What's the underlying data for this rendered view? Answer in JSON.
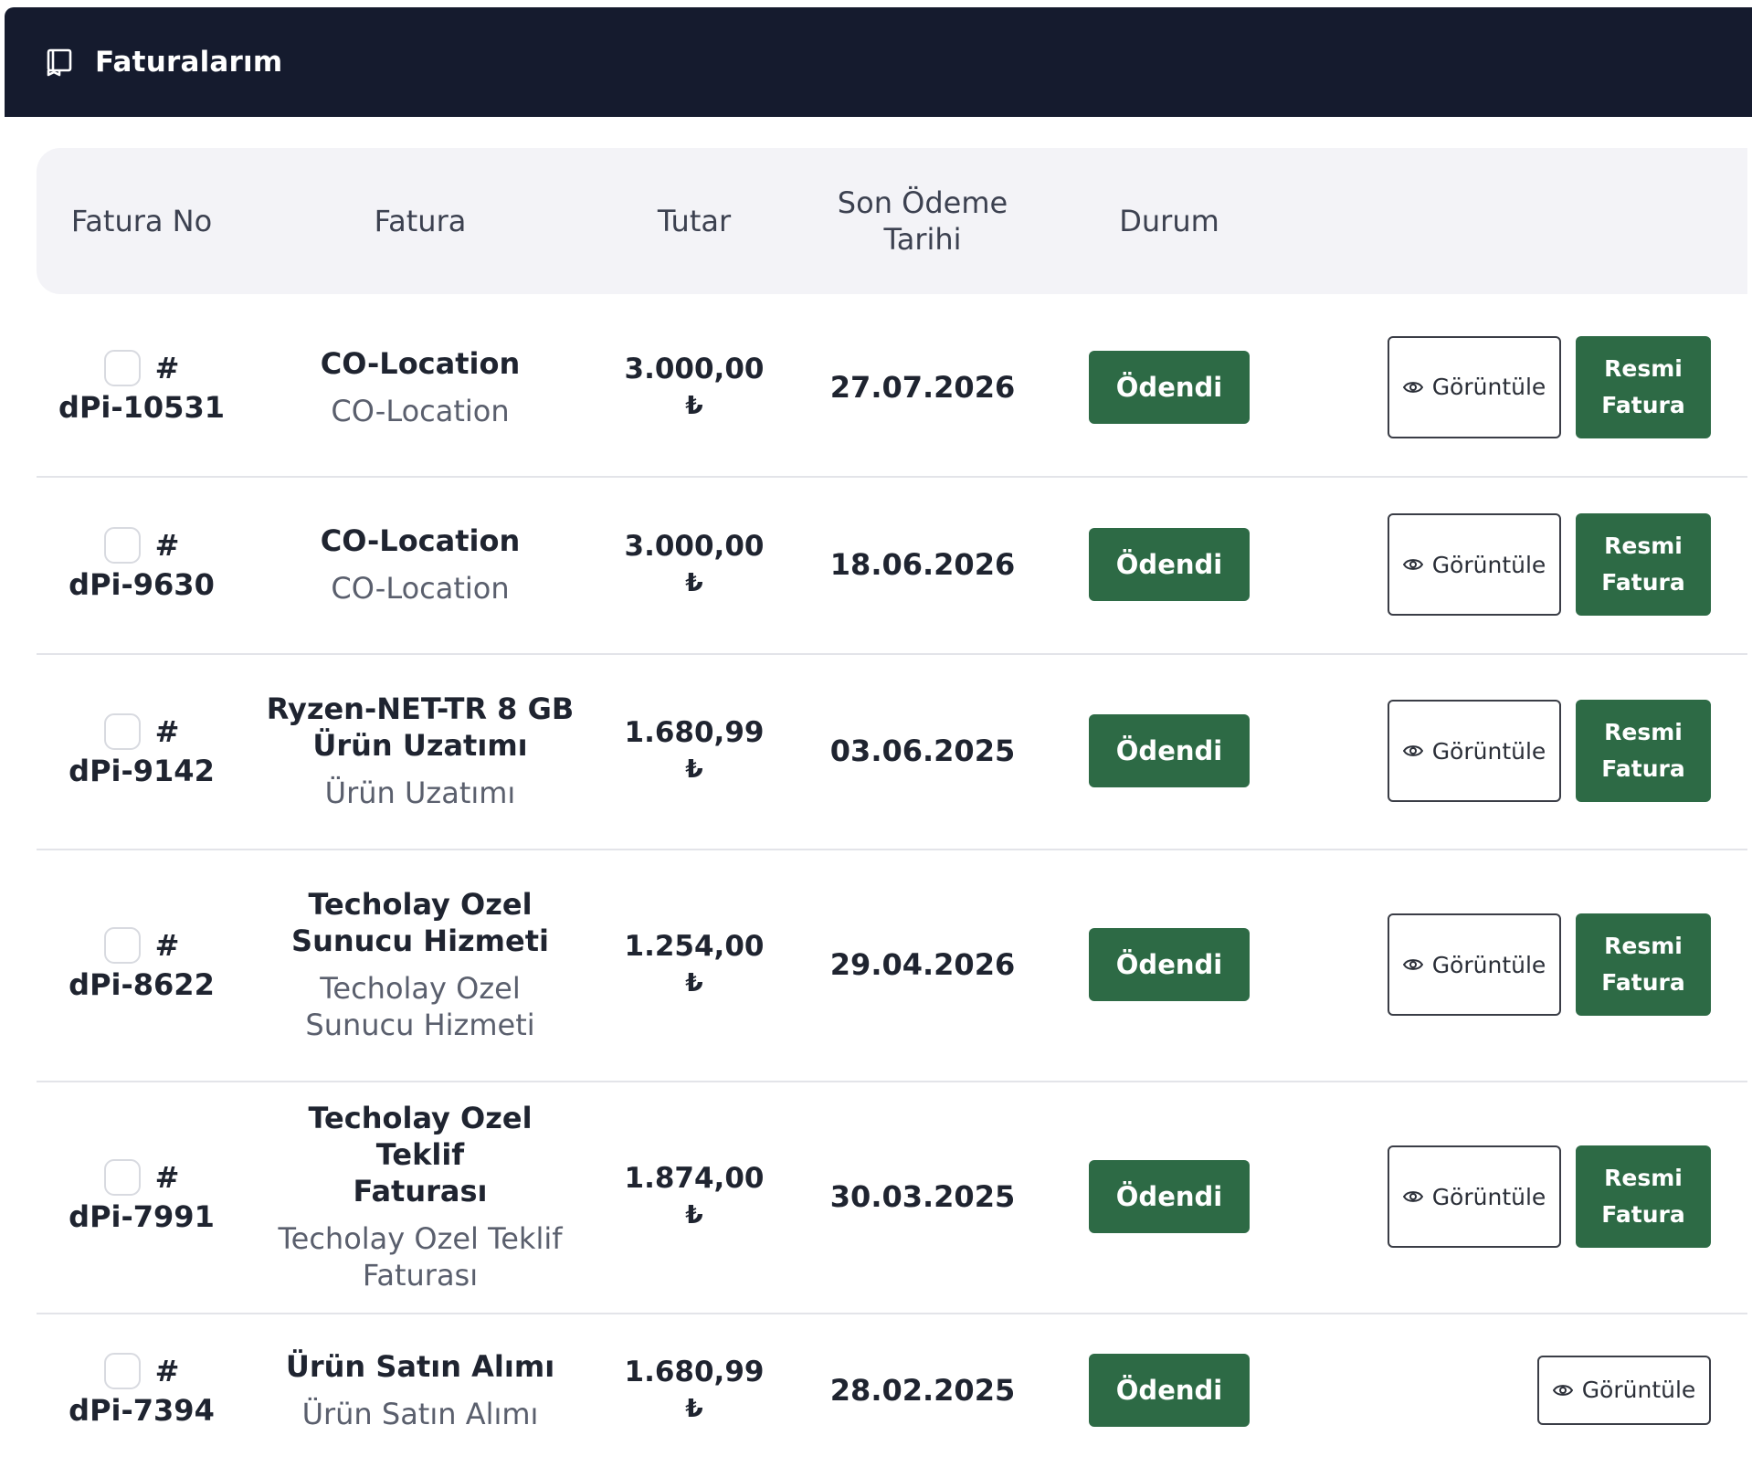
{
  "header": {
    "title": "Faturalarım",
    "icon": "receipt-icon"
  },
  "columns": [
    "Fatura No",
    "Fatura",
    "Tutar",
    "Son Ödeme\nTarihi",
    "Durum"
  ],
  "buttons": {
    "view_label": "Görüntüle",
    "official_line1": "Resmi",
    "official_line2": "Fatura"
  },
  "colors": {
    "header_bg": "#151b2e",
    "paid_green": "#2d6a45",
    "table_head_bg": "#f3f3f7"
  },
  "invoices": [
    {
      "hash": "#",
      "no": "dPi-10531",
      "title": [
        "CO-Location"
      ],
      "subtitle": [
        "CO-Location"
      ],
      "amount": "3.000,00",
      "currency": "₺",
      "due_date": "27.07.2026",
      "status": "Ödendi",
      "official": true
    },
    {
      "hash": "#",
      "no": "dPi-9630",
      "title": [
        "CO-Location"
      ],
      "subtitle": [
        "CO-Location"
      ],
      "amount": "3.000,00",
      "currency": "₺",
      "due_date": "18.06.2026",
      "status": "Ödendi",
      "official": true
    },
    {
      "hash": "#",
      "no": "dPi-9142",
      "title": [
        "Ryzen-NET-TR 8 GB",
        "Ürün Uzatımı"
      ],
      "subtitle": [
        "Ürün Uzatımı"
      ],
      "amount": "1.680,99",
      "currency": "₺",
      "due_date": "03.06.2025",
      "status": "Ödendi",
      "official": true
    },
    {
      "hash": "#",
      "no": "dPi-8622",
      "title": [
        "Techolay Ozel",
        "Sunucu Hizmeti"
      ],
      "subtitle": [
        "Techolay Ozel",
        "Sunucu Hizmeti"
      ],
      "amount": "1.254,00",
      "currency": "₺",
      "due_date": "29.04.2026",
      "status": "Ödendi",
      "official": true
    },
    {
      "hash": "#",
      "no": "dPi-7991",
      "title": [
        "Techolay Ozel Teklif",
        "Faturası"
      ],
      "subtitle": [
        "Techolay Ozel Teklif",
        "Faturası"
      ],
      "amount": "1.874,00",
      "currency": "₺",
      "due_date": "30.03.2025",
      "status": "Ödendi",
      "official": true
    },
    {
      "hash": "#",
      "no": "dPi-7394",
      "title": [
        "Ürün Satın Alımı"
      ],
      "subtitle": [
        "Ürün Satın Alımı"
      ],
      "amount": "1.680,99",
      "currency": "₺",
      "due_date": "28.02.2025",
      "status": "Ödendi",
      "official": false
    }
  ]
}
